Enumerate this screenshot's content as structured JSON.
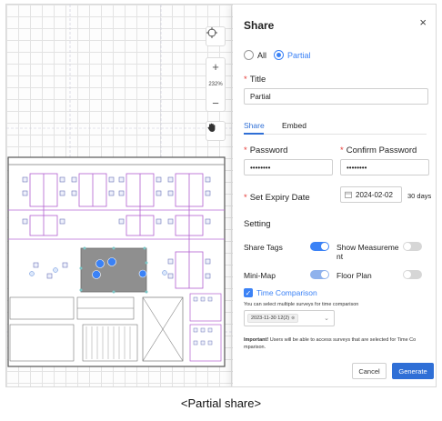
{
  "map": {
    "zoom_in": "+",
    "zoom_level": "232%",
    "zoom_out": "−"
  },
  "share": {
    "title": "Share",
    "close": "×",
    "mode": {
      "all_label": "All",
      "partial_label": "Partial",
      "selected": "Partial"
    },
    "title_label": "Title",
    "title_value": "Partial",
    "tabs": [
      {
        "label": "Share",
        "active": true
      },
      {
        "label": "Embed",
        "active": false
      }
    ],
    "password_label": "Password",
    "password_value": "••••••••",
    "confirm_label": "Confirm Password",
    "confirm_value": "••••••••",
    "expiry_label": "Set Expiry Date",
    "expiry_value": "2024-02-02",
    "expiry_days": "30 days",
    "setting_heading": "Setting",
    "settings": {
      "share_tags": {
        "label": "Share Tags",
        "on": true
      },
      "show_measurement": {
        "label": "Show Measureme nt",
        "on": false
      },
      "mini_map": {
        "label": "Mini-Map",
        "on": true
      },
      "floor_plan": {
        "label": "Floor Plan",
        "on": false
      }
    },
    "time_comparison": {
      "label": "Time Comparison",
      "checked": true,
      "hint": "You can select multiple surveys for time comparison",
      "chip": "2023-11-30 12(2)"
    },
    "note_bold": "Important!",
    "note_text": " Users will be able to access surveys that are selected for Time Co mparison.",
    "cancel_label": "Cancel",
    "generate_label": "Generate"
  },
  "caption": "<Partial share>",
  "colors": {
    "accent": "#3b82f6",
    "primary_button": "#2f6fd6",
    "required": "#e53935"
  }
}
